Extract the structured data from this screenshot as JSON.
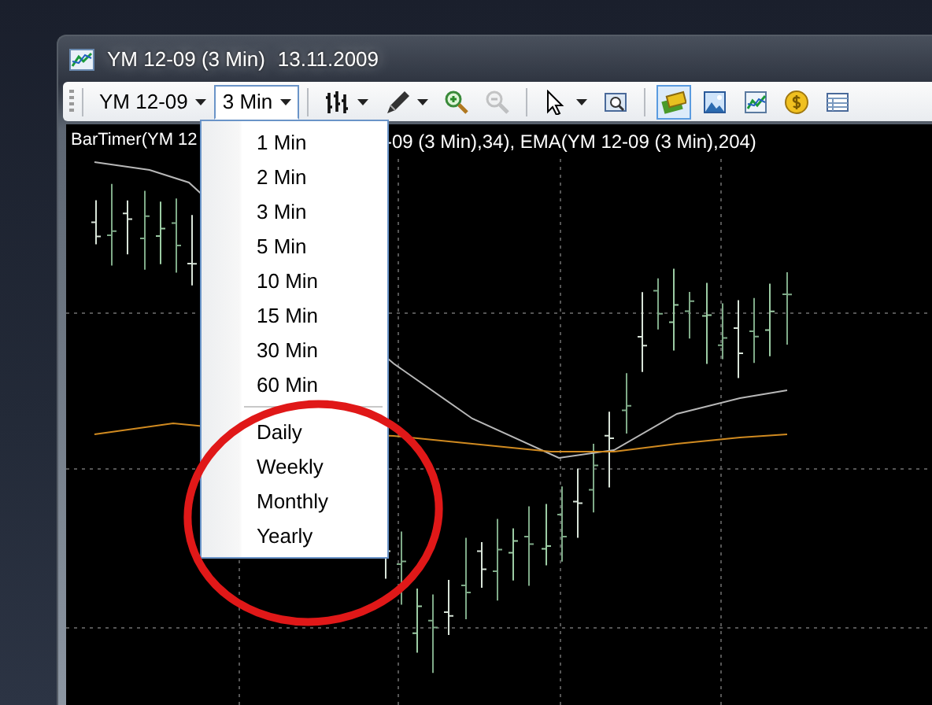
{
  "window": {
    "title": "YM 12-09 (3 Min)",
    "date": "13.11.2009"
  },
  "toolbar": {
    "dropdowns": [
      {
        "label": "YM 12-09",
        "open": false
      },
      {
        "label": "3 Min",
        "open": true
      }
    ],
    "tools": [
      {
        "disabled": false,
        "pressed": false
      },
      {
        "disabled": false,
        "pressed": false
      },
      {
        "disabled": false,
        "pressed": false
      },
      {
        "disabled": true,
        "pressed": false
      },
      {
        "disabled": false,
        "pressed": false
      },
      {
        "disabled": false,
        "pressed": false
      },
      {
        "disabled": false,
        "pressed": true
      },
      {
        "disabled": false,
        "pressed": false
      },
      {
        "disabled": false,
        "pressed": false
      },
      {
        "disabled": false,
        "pressed": false
      },
      {
        "disabled": false,
        "pressed": false
      }
    ]
  },
  "legend": [
    "BarTimer(YM 12",
    "-09 (3 Min),34), EMA(YM 12-09 (3 Min),204)"
  ],
  "menu": {
    "groups": [
      [
        "1 Min",
        "2 Min",
        "3 Min",
        "5 Min",
        "10 Min",
        "15 Min",
        "30 Min",
        "60 Min"
      ],
      [
        "Daily",
        "Weekly",
        "Monthly",
        "Yearly"
      ]
    ]
  }
}
